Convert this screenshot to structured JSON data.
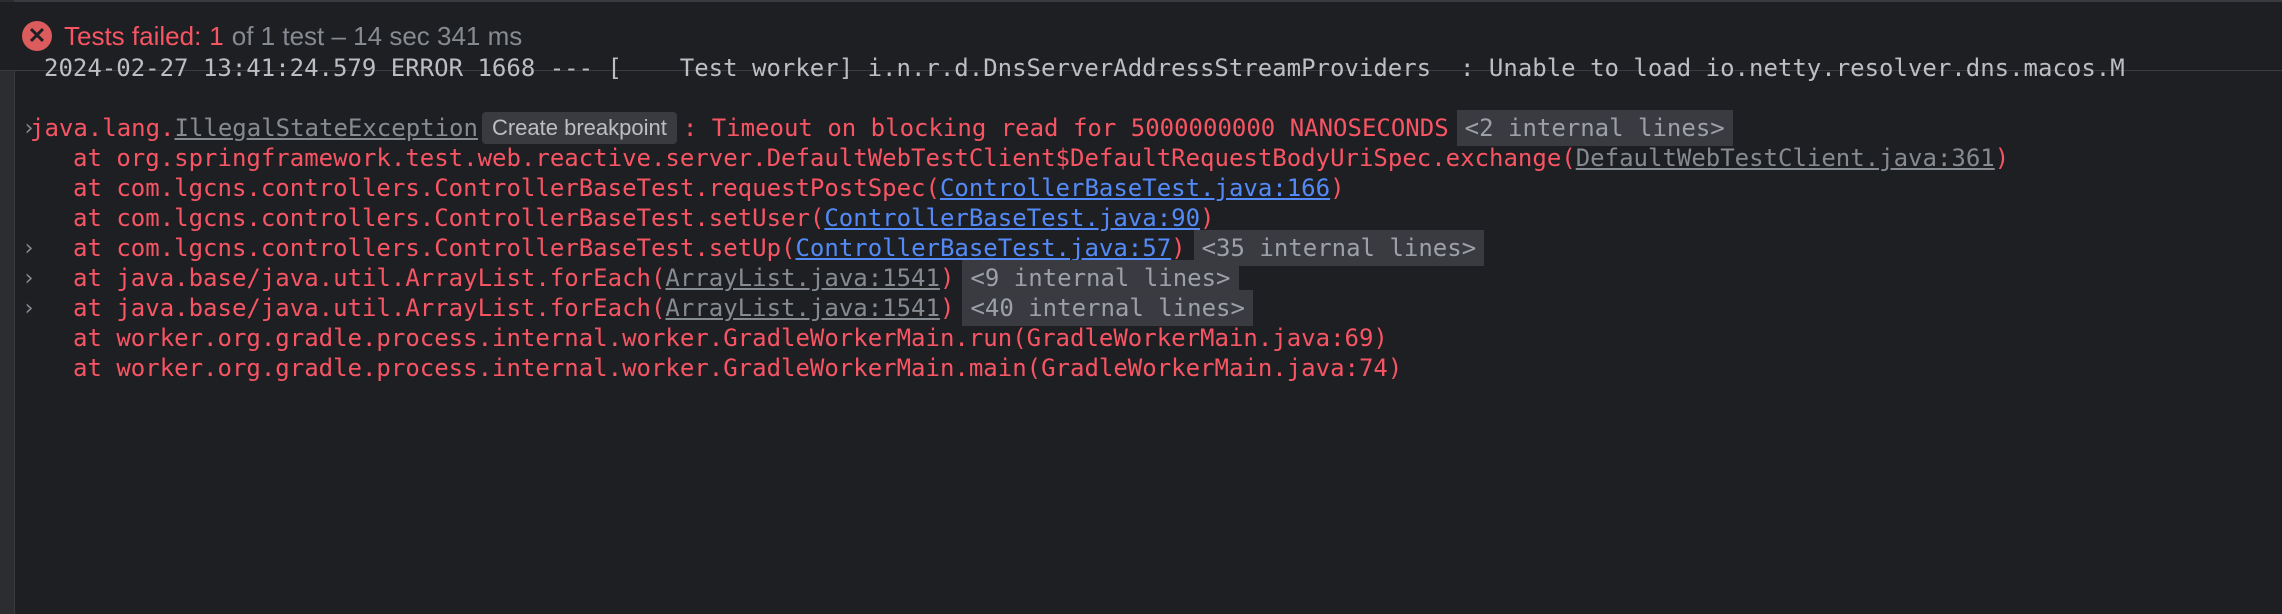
{
  "status": {
    "icon": "x-circle-icon",
    "failed_label": "Tests failed:",
    "failed_count": "1",
    "summary": "of 1 test – 14 sec 341 ms",
    "colors": {
      "failed": "#f75464",
      "muted": "#868a91"
    }
  },
  "console": {
    "log_line": "2024-02-27 13:41:24.579 ERROR 1668 --- [    Test worker] i.n.r.d.DnsServerAddressStreamProviders  : Unable to load io.netty.resolver.dns.macos.M",
    "exception": {
      "prefix": "java.lang.",
      "class_name": "IllegalStateException",
      "breakpoint_label": "Create breakpoint",
      "message": ": Timeout on blocking read for 5000000000 NANOSECONDS",
      "internal_lines": "<2 internal lines>"
    },
    "frames": [
      {
        "call": "at org.springframework.test.web.reactive.server.DefaultWebTestClient$DefaultRequestBodyUriSpec.exchange(",
        "link": "DefaultWebTestClient.java:361",
        "close": ")",
        "internal": ""
      },
      {
        "call": "at com.lgcns.controllers.ControllerBaseTest.requestPostSpec(",
        "link": "ControllerBaseTest.java:166",
        "close": ")",
        "internal": ""
      },
      {
        "call": "at com.lgcns.controllers.ControllerBaseTest.setUser(",
        "link": "ControllerBaseTest.java:90",
        "close": ")",
        "internal": ""
      },
      {
        "call": "at com.lgcns.controllers.ControllerBaseTest.setUp(",
        "link": "ControllerBaseTest.java:57",
        "close": ")",
        "internal": "<35 internal lines>"
      },
      {
        "call": "at java.base/java.util.ArrayList.forEach(",
        "link": "ArrayList.java:1541",
        "close": ")",
        "internal": "<9 internal lines>"
      },
      {
        "call": "at java.base/java.util.ArrayList.forEach(",
        "link": "ArrayList.java:1541",
        "close": ")",
        "internal": "<40 internal lines>"
      },
      {
        "text": "at worker.org.gradle.process.internal.worker.GradleWorkerMain.run(GradleWorkerMain.java:69)"
      },
      {
        "text": "at worker.org.gradle.process.internal.worker.GradleWorkerMain.main(GradleWorkerMain.java:74)"
      }
    ]
  },
  "colors": {
    "background": "#1e1f22",
    "error_text": "#f75464",
    "link_blue": "#548af7",
    "link_gray": "#868a91",
    "chip_bg": "#393b40"
  }
}
